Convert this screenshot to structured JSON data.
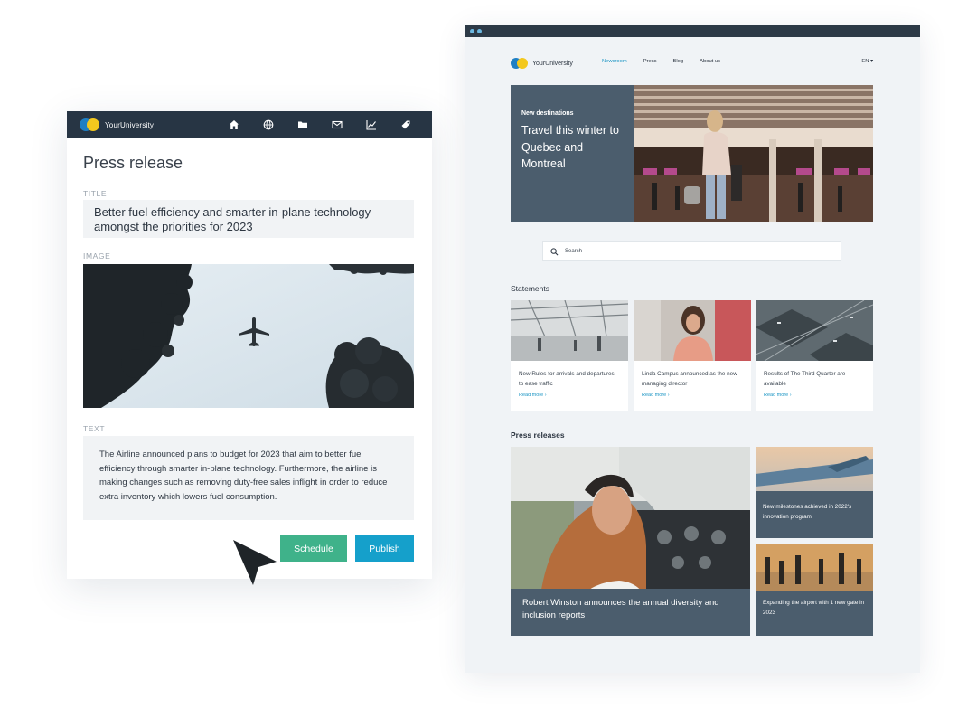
{
  "editor": {
    "brand": "YourUniversity",
    "nav_icons": [
      "home-icon",
      "globe-icon",
      "folder-icon",
      "mail-icon",
      "chart-icon",
      "tag-icon"
    ],
    "heading": "Press release",
    "title_label": "TITLE",
    "title_value": "Better fuel efficiency and smarter in-plane technology amongst the priorities for 2023",
    "image_label": "IMAGE",
    "text_label": "TEXT",
    "text_value": "The Airline announced plans to budget for 2023 that aim to better fuel efficiency through smarter in-plane technology. Furthermore, the airline is making changes such as removing duty-free sales inflight in order to reduce extra inventory which lowers fuel consumption.",
    "schedule_label": "Schedule",
    "publish_label": "Publish"
  },
  "site": {
    "brand": "YourUniversity",
    "nav": [
      "Newsroom",
      "Press",
      "Blog",
      "About us"
    ],
    "active_nav": "Newsroom",
    "lang": "EN ▾",
    "hero": {
      "kicker": "New destinations",
      "title": "Travel this winter to Quebec and Montreal"
    },
    "search_placeholder": "Search",
    "statements_title": "Statements",
    "statements": [
      {
        "text": "New Rules for arrivals and departures to ease traffic",
        "link": "Read more ›"
      },
      {
        "text": "Linda Campus announced as the new managing director",
        "link": "Read more ›"
      },
      {
        "text": "Results of The Third Quarter are available",
        "link": "Read more ›"
      }
    ],
    "press_title": "Press releases",
    "press": [
      {
        "text": "Robert Winston announces the annual diversity and inclusion reports"
      },
      {
        "text": "New milestones achieved in 2022's innovation program"
      },
      {
        "text": "Expanding the airport with 1 new gate in 2023"
      }
    ]
  },
  "colors": {
    "editor_bar": "#273544",
    "schedule": "#3fb28a",
    "publish": "#15a0cb",
    "panel": "#4b5d6d",
    "link": "#1b95c4"
  }
}
